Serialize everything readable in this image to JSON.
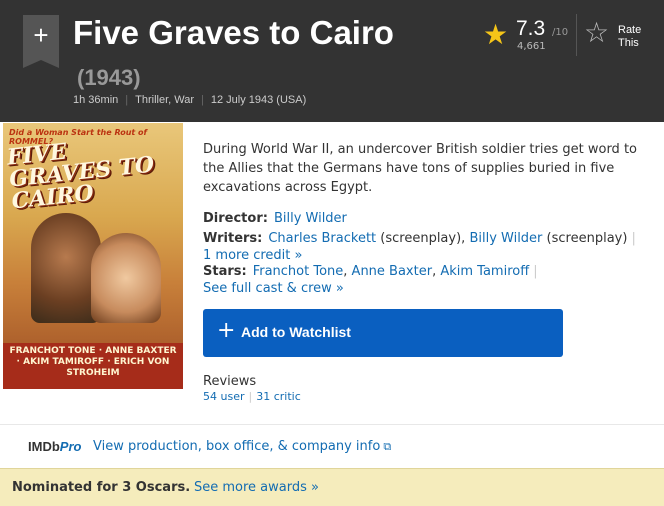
{
  "header": {
    "title": "Five Graves to Cairo",
    "year": "(1943)",
    "runtime": "1h 36min",
    "genres": "Thriller, War",
    "release": "12 July 1943 (USA)",
    "add_icon": "plus-icon"
  },
  "rating": {
    "value": "7.3",
    "best": "/10",
    "count": "4,661",
    "star_icon": "star-icon",
    "rate_label": "Rate This",
    "rate_icon": "star-outline-icon"
  },
  "poster": {
    "tagline": "Did a Woman Start the Rout of ROMMEL?",
    "title": "FIVE GRAVES TO CAIRO",
    "names": "FRANCHOT TONE · ANNE BAXTER · AKIM TAMIROFF · ERICH VON STROHEIM"
  },
  "plot": "During World War II, an undercover British soldier tries get word to the Allies that the Germans have tons of supplies buried in five excavations across Egypt.",
  "credits": {
    "director_label": "Director:",
    "director": "Billy Wilder",
    "writers_label": "Writers:",
    "writer1": "Charles Brackett",
    "writer1_role": "(screenplay)",
    "writer2": "Billy Wilder",
    "writer2_role": "(screenplay)",
    "more_credit": "1 more credit »",
    "stars_label": "Stars:",
    "star1": "Franchot Tone",
    "star2": "Anne Baxter",
    "star3": "Akim Tamiroff",
    "full_cast": "See full cast & crew »"
  },
  "watchlist": {
    "label": "Add to Watchlist"
  },
  "reviews": {
    "title": "Reviews",
    "user": "54 user",
    "critic": "31 critic"
  },
  "imdbpro": {
    "logo_main": "IMDb",
    "logo_pro": "Pro",
    "link": "View production, box office, & company info"
  },
  "awards": {
    "text": "Nominated for 3 Oscars.",
    "link": "See more awards »"
  },
  "colors": {
    "header_bg": "#333333",
    "accent_star": "#f5c518",
    "link": "#136cb2",
    "watchlist_btn": "#0a5fc0",
    "awards_bg": "#f5ecbc"
  }
}
